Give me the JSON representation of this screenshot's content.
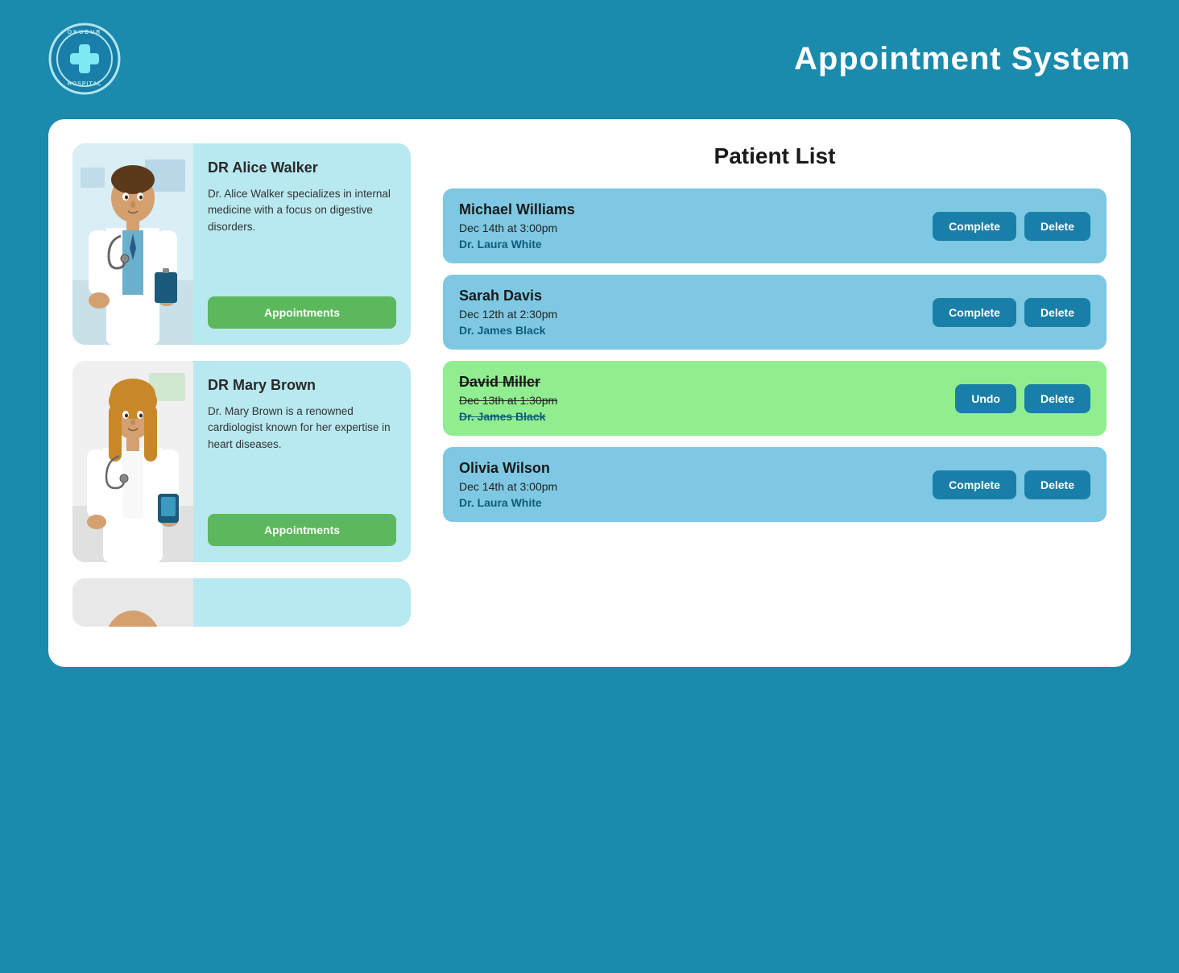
{
  "header": {
    "app_title": "Appointment System",
    "logo_top_text": "OKUDUR",
    "logo_bottom_text": "HOSPITAL"
  },
  "doctors": [
    {
      "id": "dr-alice-walker",
      "name": "DR Alice Walker",
      "description": "Dr. Alice Walker specializes in internal medicine with a focus on digestive disorders.",
      "appointments_label": "Appointments",
      "gender": "male"
    },
    {
      "id": "dr-mary-brown",
      "name": "DR Mary Brown",
      "description": "Dr. Mary Brown is a renowned cardiologist known for her expertise in heart diseases.",
      "appointments_label": "Appointments",
      "gender": "female"
    }
  ],
  "patient_list": {
    "title": "Patient List",
    "patients": [
      {
        "id": "michael-williams",
        "name": "Michael Williams",
        "datetime": "Dec 14th at 3:00pm",
        "doctor": "Dr. Laura White",
        "status": "pending",
        "complete_label": "Complete",
        "delete_label": "Delete"
      },
      {
        "id": "sarah-davis",
        "name": "Sarah Davis",
        "datetime": "Dec 12th at 2:30pm",
        "doctor": "Dr. James Black",
        "status": "pending",
        "complete_label": "Complete",
        "delete_label": "Delete"
      },
      {
        "id": "david-miller",
        "name": "David Miller",
        "datetime": "Dec 13th at 1:30pm",
        "doctor": "Dr. James Black",
        "status": "completed",
        "undo_label": "Undo",
        "delete_label": "Delete"
      },
      {
        "id": "olivia-wilson",
        "name": "Olivia Wilson",
        "datetime": "Dec 14th at 3:00pm",
        "doctor": "Dr. Laura White",
        "status": "pending",
        "complete_label": "Complete",
        "delete_label": "Delete"
      }
    ]
  }
}
